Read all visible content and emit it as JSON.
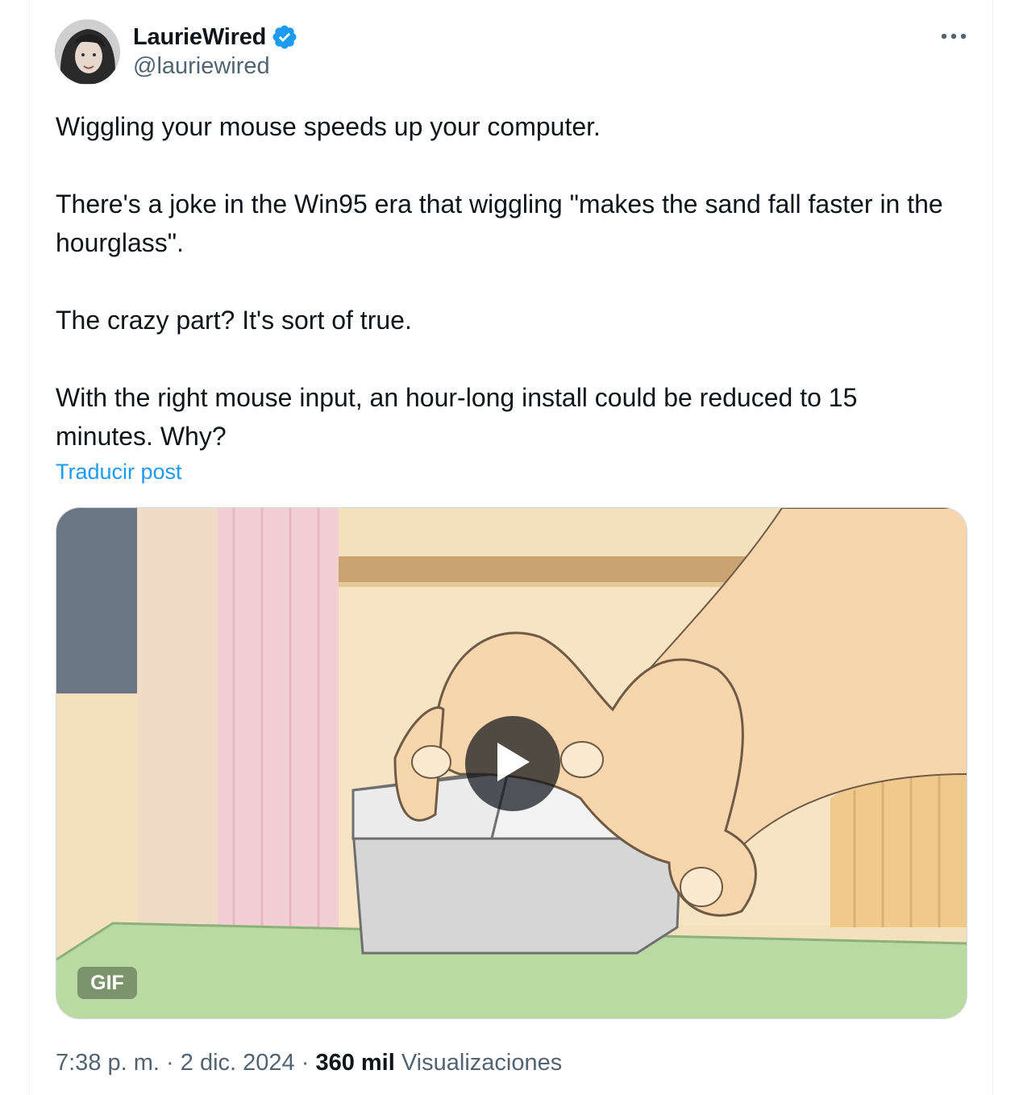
{
  "author": {
    "display_name": "LaurieWired",
    "handle": "@lauriewired",
    "verified": true,
    "verified_icon": "verified-badge-icon"
  },
  "tweet": {
    "paragraphs": [
      "Wiggling your mouse speeds up your computer.",
      "There's a joke in the Win95 era that wiggling \"makes the sand fall faster in the hourglass\".",
      "The crazy part?  It's sort of true.",
      "With the right mouse input, an hour-long install could be reduced to 15 minutes.  Why?"
    ],
    "translate_label": "Traducir post"
  },
  "media": {
    "badge": "GIF",
    "play_icon": "play-icon"
  },
  "meta": {
    "time": "7:38 p. m.",
    "separator": "·",
    "date": "2 dic. 2024",
    "views_count": "360 mil",
    "views_label": "Visualizaciones"
  },
  "colors": {
    "accent": "#1d9bf0",
    "text_primary": "#0f1419",
    "text_secondary": "#536471"
  }
}
